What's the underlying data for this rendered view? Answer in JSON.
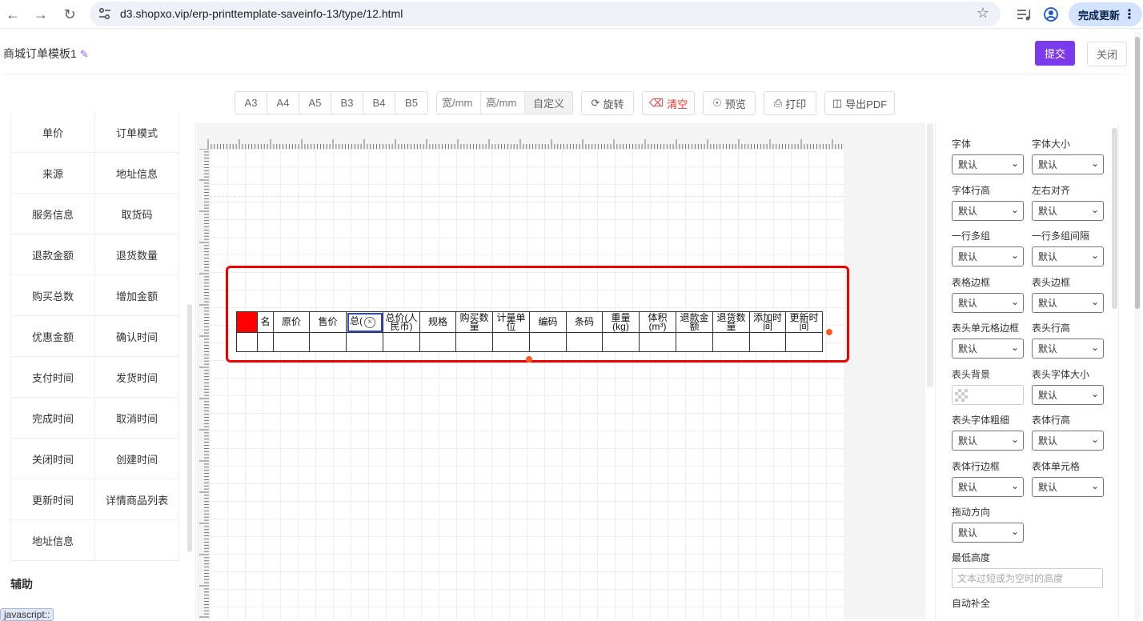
{
  "browser": {
    "url": "d3.shopxo.vip/erp-printtemplate-saveinfo-13/type/12.html",
    "update_label": "完成更新",
    "status_tip": "javascript::"
  },
  "header": {
    "title": "商城订单模板1",
    "submit_label": "提交",
    "close_label": "关闭"
  },
  "toolbar": {
    "sizes": [
      "A3",
      "A4",
      "A5",
      "B3",
      "B4",
      "B5"
    ],
    "width_placeholder": "宽/mm",
    "height_placeholder": "高/mm",
    "custom_label": "自定义",
    "rotate_label": "旋转",
    "clear_label": "清空",
    "preview_label": "预览",
    "print_label": "打印",
    "export_label": "导出PDF"
  },
  "left_panel": {
    "fields": [
      "单价",
      "订单模式",
      "来源",
      "地址信息",
      "服务信息",
      "取货码",
      "退款金额",
      "退货数量",
      "购买总数",
      "增加金额",
      "优惠金额",
      "确认时间",
      "支付时间",
      "发货时间",
      "完成时间",
      "取消时间",
      "关闭时间",
      "创建时间",
      "更新时间",
      "详情商品列表",
      "地址信息"
    ],
    "aux_title": "辅助"
  },
  "table": {
    "headers": [
      "",
      "名",
      "原价",
      "售价",
      "总(",
      "总价(人民币)",
      "规格",
      "购买数量",
      "计量单位",
      "编码",
      "条码",
      "重量(kg)",
      "体积(m³)",
      "退款金额",
      "退货数量",
      "添加时间",
      "更新时间"
    ],
    "accent": "#ff0000"
  },
  "right_panel": {
    "props": [
      {
        "label": "字体",
        "value": "默认"
      },
      {
        "label": "字体大小",
        "value": "默认"
      },
      {
        "label": "字体行高",
        "value": "默认"
      },
      {
        "label": "左右对齐",
        "value": "默认"
      },
      {
        "label": "一行多组",
        "value": "默认"
      },
      {
        "label": "一行多组间隔",
        "value": "默认"
      },
      {
        "label": "表格边框",
        "value": "默认"
      },
      {
        "label": "表头边框",
        "value": "默认"
      },
      {
        "label": "表头单元格边框",
        "value": "默认"
      },
      {
        "label": "表头行高",
        "value": "默认"
      },
      {
        "label": "表头背景",
        "value": ""
      },
      {
        "label": "表头字体大小",
        "value": "默认"
      },
      {
        "label": "表头字体粗细",
        "value": "默认"
      },
      {
        "label": "表体行高",
        "value": "默认"
      },
      {
        "label": "表体行边框",
        "value": "默认"
      },
      {
        "label": "表体单元格",
        "value": "默认"
      },
      {
        "label": "拖动方向",
        "value": "默认"
      }
    ],
    "min_height_label": "最低高度",
    "min_height_placeholder": "文本过短或为空时的高度",
    "autocomplete_label": "自动补全"
  },
  "colors": {
    "primary": "#7c3aed",
    "selection": "#e00000",
    "handle": "#ff5a1f"
  }
}
